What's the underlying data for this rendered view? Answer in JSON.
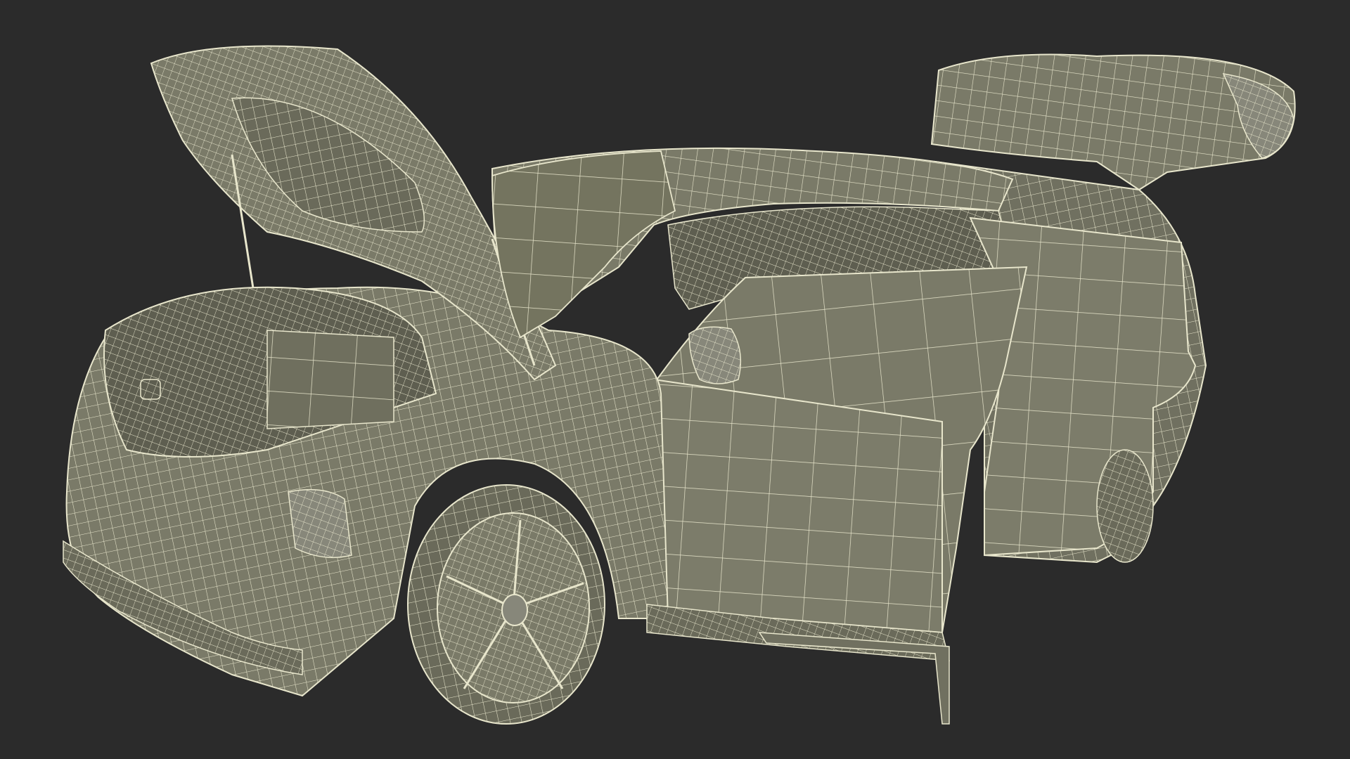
{
  "image": {
    "subject": "car-wireframe-render"
  },
  "colors": {
    "background": "#2b2b2b",
    "surface": "#7a7a68",
    "surface_dark": "#6a6a5a",
    "surface_light": "#87877a",
    "wire": "#e8e6cc",
    "shadow": "#55554a"
  }
}
